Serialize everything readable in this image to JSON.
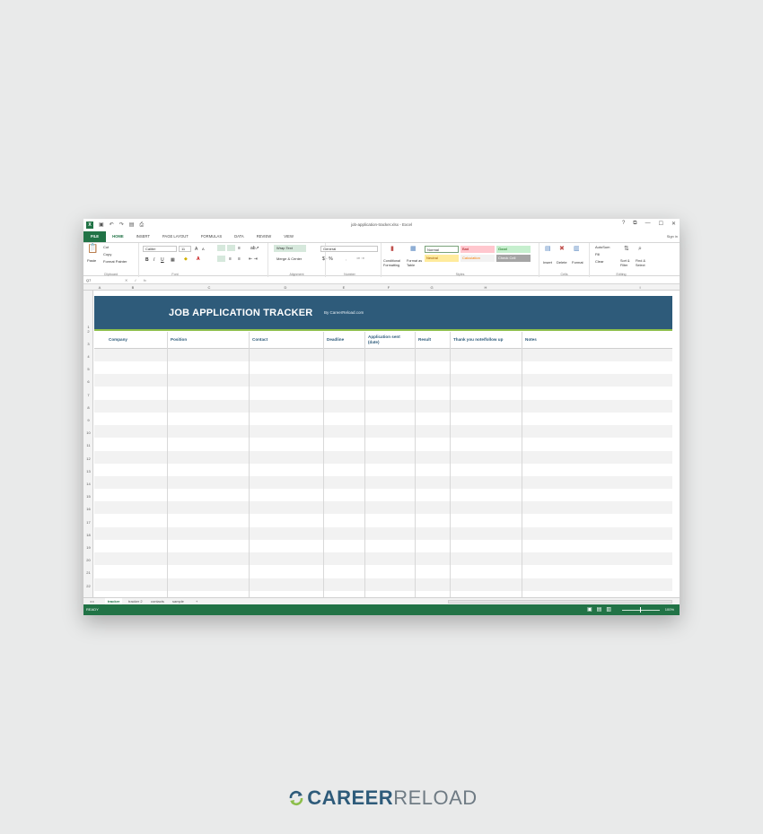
{
  "window": {
    "title": "job-application-tracker.xlsx - Excel",
    "controls": [
      "?",
      "⧉",
      "—",
      "☐",
      "✕"
    ],
    "sign_in": "Sign in"
  },
  "ribbon_tabs": [
    "FILE",
    "HOME",
    "INSERT",
    "PAGE LAYOUT",
    "FORMULAS",
    "DATA",
    "REVIEW",
    "VIEW"
  ],
  "ribbon": {
    "clipboard": {
      "paste": "Paste",
      "cut": "Cut",
      "copy": "Copy",
      "format_painter": "Format Painter",
      "label": "Clipboard"
    },
    "font": {
      "name": "Calibri",
      "size": "11",
      "label": "Font"
    },
    "alignment": {
      "wrap": "Wrap Text",
      "merge": "Merge & Center",
      "label": "Alignment"
    },
    "number": {
      "format": "General",
      "label": "Number"
    },
    "styles": {
      "conditional": "Conditional Formatting",
      "format_table": "Format as Table",
      "cells": [
        {
          "label": "Normal",
          "bg": "#ffffff",
          "fg": "#333333"
        },
        {
          "label": "Bad",
          "bg": "#ffc7ce",
          "fg": "#9c0006"
        },
        {
          "label": "Good",
          "bg": "#c6efce",
          "fg": "#006100"
        },
        {
          "label": "Neutral",
          "bg": "#ffeb9c",
          "fg": "#9c5700"
        },
        {
          "label": "Calculation",
          "bg": "#f2f2f2",
          "fg": "#fa7d00"
        },
        {
          "label": "Check Cell",
          "bg": "#a5a5a5",
          "fg": "#ffffff"
        }
      ],
      "label": "Styles"
    },
    "cells": {
      "insert": "Insert",
      "delete": "Delete",
      "format": "Format",
      "label": "Cells"
    },
    "editing": {
      "autosum": "AutoSum",
      "fill": "Fill",
      "clear": "Clear",
      "sort": "Sort & Filter",
      "find": "Find & Select",
      "label": "Editing"
    }
  },
  "formula_bar": {
    "name_box": "Q7",
    "fx": "fx"
  },
  "columns": [
    "A",
    "B",
    "C",
    "D",
    "E",
    "F",
    "G",
    "H",
    "I"
  ],
  "rows": [
    "1",
    "2",
    "3",
    "4",
    "5",
    "6",
    "7",
    "8",
    "9",
    "10",
    "11",
    "12",
    "13",
    "14",
    "15",
    "16",
    "17",
    "18",
    "19",
    "20",
    "21",
    "22"
  ],
  "sheet": {
    "title": "JOB APPLICATION TRACKER",
    "subtitle": "By CareerReload.com",
    "headers": [
      "Company",
      "Position",
      "Contact",
      "Deadline",
      "Application sent (date)",
      "Result",
      "Thank you note/follow up",
      "Notes"
    ],
    "accent": "#2e5b7a",
    "accent_line": "#8cbe4a"
  },
  "sheet_tabs": [
    "tracker",
    "tracker 2",
    "contacts",
    "sample",
    "+"
  ],
  "status": {
    "ready": "READY",
    "zoom": "100%"
  },
  "brand": {
    "career": "CAREER",
    "reload": "RELOAD"
  }
}
